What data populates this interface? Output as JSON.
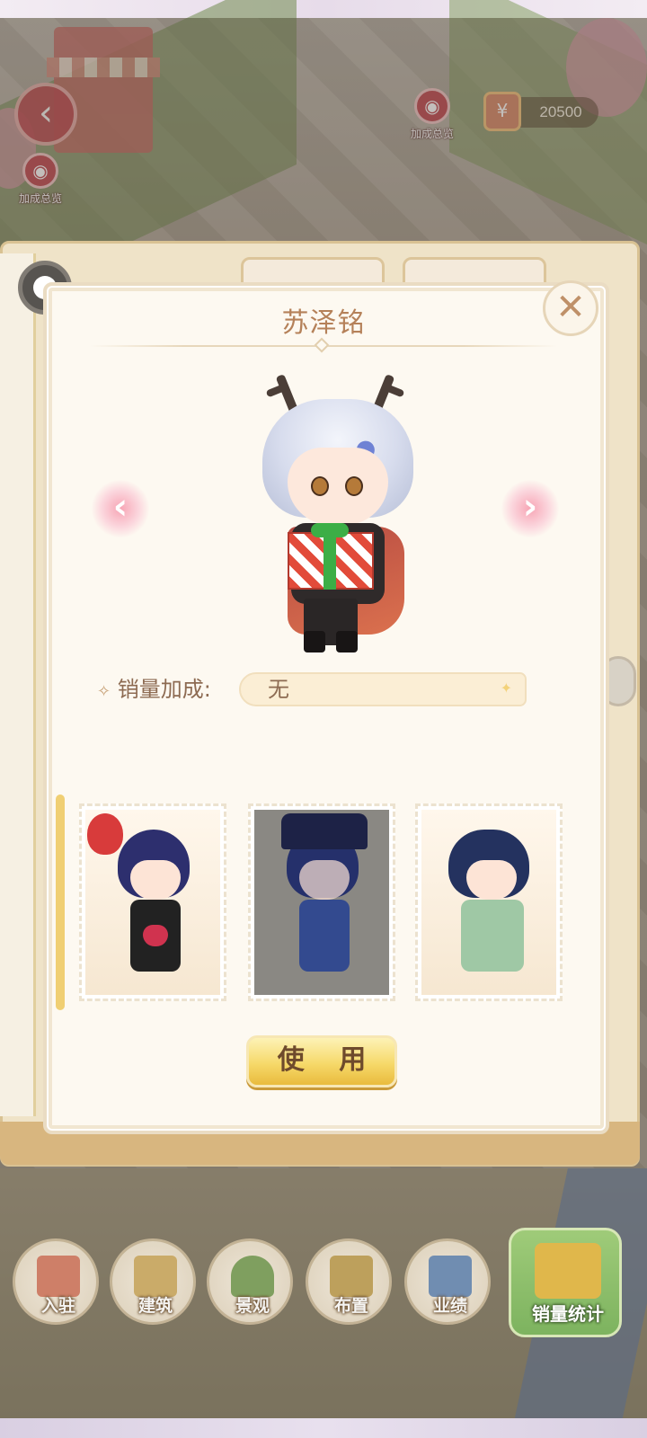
{
  "game_hud": {
    "bonus_overview_label": "加成总览",
    "coins": "20500"
  },
  "dialog": {
    "character_name": "苏泽铭",
    "sales_bonus_label": "销量加成:",
    "sales_bonus_value": "无",
    "use_button_label": "使 用",
    "prev_arrow": "‹",
    "next_arrow": "›",
    "close_symbol": "✕"
  },
  "outfit_cards": [
    {
      "id": "outfit-balloon",
      "selected": false
    },
    {
      "id": "outfit-captain",
      "selected": false,
      "dimmed": true
    },
    {
      "id": "outfit-green-robe",
      "selected": false
    }
  ],
  "bottom_nav": [
    {
      "label": "入驻",
      "icon": "shop-icon"
    },
    {
      "label": "建筑",
      "icon": "building-icon"
    },
    {
      "label": "景观",
      "icon": "tree-icon"
    },
    {
      "label": "布置",
      "icon": "decor-icon"
    },
    {
      "label": "业绩",
      "icon": "chart-icon"
    }
  ],
  "sales_stats": {
    "label": "销量统计",
    "icon": "sales-stats-icon"
  },
  "colors": {
    "accent_gold": "#f6d96a",
    "title_brown": "#b58159",
    "arrow_pink": "#f7a5b5"
  }
}
